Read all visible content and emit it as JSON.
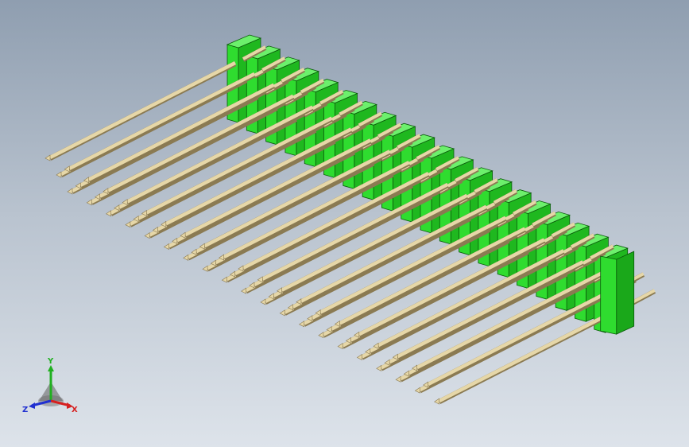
{
  "model": {
    "part": "pin-header-3x20",
    "rows": 3,
    "positions": 20,
    "housing_color": "#2fdc2f",
    "pin_color": "#e6d7a8"
  },
  "triad": {
    "labels": {
      "x": "X",
      "y": "Y",
      "z": "Z"
    },
    "colors": {
      "x": "#d62020",
      "y": "#20b020",
      "z": "#2030d0"
    }
  }
}
